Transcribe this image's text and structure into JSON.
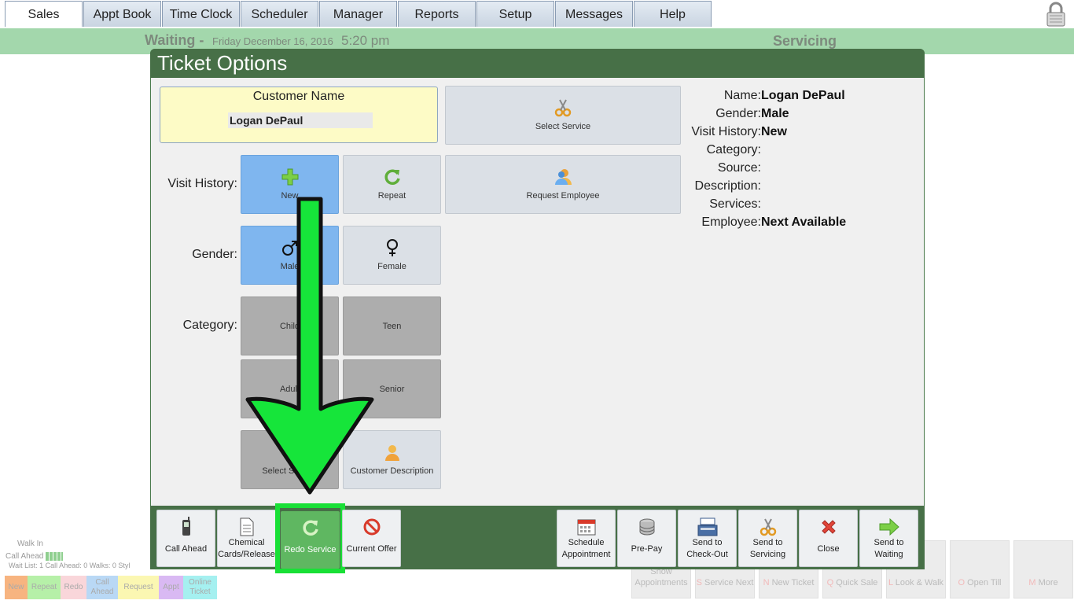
{
  "nav": {
    "tabs": [
      "Sales",
      "Appt Book",
      "Time Clock",
      "Scheduler",
      "Manager",
      "Reports",
      "Setup",
      "Messages",
      "Help"
    ],
    "active_tab": "Sales"
  },
  "status": {
    "waiting_label": "Waiting -",
    "date": "Friday December 16, 2016",
    "time": "5:20 pm",
    "servicing_label": "Servicing"
  },
  "background": {
    "walk_in": "Walk In",
    "call_ahead": "Call Ahead",
    "wait_list": "Wait List: 1   Call Ahead: 0   Walks: 0   Styl",
    "legend": [
      {
        "label": "New",
        "color": "#f7b480"
      },
      {
        "label": "Repeat",
        "color": "#b6f0a8"
      },
      {
        "label": "Redo",
        "color": "#f9d6da"
      },
      {
        "label": "Call Ahead",
        "color": "#b9d8f5"
      },
      {
        "label": "Request",
        "color": "#fbf7b2"
      },
      {
        "label": "Appt",
        "color": "#d9b9f3"
      },
      {
        "label": "Online Ticket",
        "color": "#a5f0f0"
      }
    ],
    "buttons": [
      {
        "key": "",
        "label": "Show Appointments"
      },
      {
        "key": "S",
        "label": "Service Next"
      },
      {
        "key": "N",
        "label": "New Ticket"
      },
      {
        "key": "Q",
        "label": "Quick Sale"
      },
      {
        "key": "L",
        "label": "Look & Walk"
      },
      {
        "key": "O",
        "label": "Open Till"
      },
      {
        "key": "M",
        "label": "More"
      }
    ]
  },
  "modal": {
    "title": "Ticket Options",
    "customer_name_label": "Customer Name",
    "customer_name_value": "Logan DePaul",
    "select_service_top": "Select Service",
    "request_employee": "Request Employee",
    "visit_history_label": "Visit History:",
    "gender_label": "Gender:",
    "category_label": "Category:",
    "visit_options": [
      {
        "label": "New",
        "selected": true,
        "icon": "plus-icon"
      },
      {
        "label": "Repeat",
        "selected": false,
        "icon": "refresh-icon"
      }
    ],
    "gender_options": [
      {
        "label": "Male",
        "selected": true,
        "icon": "male-icon"
      },
      {
        "label": "Female",
        "selected": false,
        "icon": "female-icon"
      }
    ],
    "category_options": [
      "Child",
      "Teen",
      "Adult",
      "Senior"
    ],
    "select_service_bottom": "Select Service",
    "customer_description": "Customer Description",
    "info": {
      "name_k": "Name:",
      "name_v": "Logan DePaul",
      "gender_k": "Gender:",
      "gender_v": "Male",
      "visit_k": "Visit History:",
      "visit_v": "New",
      "category_k": "Category:",
      "category_v": "",
      "source_k": "Source:",
      "source_v": "",
      "description_k": "Description:",
      "description_v": "",
      "services_k": "Services:",
      "services_v": "",
      "employee_k": "Employee:",
      "employee_v": "Next Available"
    },
    "footer_left": [
      {
        "label": "Call Ahead",
        "icon": "phone-icon"
      },
      {
        "label": "Chemical Cards/Release",
        "icon": "document-icon"
      },
      {
        "label": "Redo Service",
        "icon": "redo-icon"
      },
      {
        "label": "Current Offer",
        "icon": "no-icon"
      }
    ],
    "footer_right": [
      {
        "label": "Schedule Appointment",
        "icon": "calendar-icon"
      },
      {
        "label": "Pre-Pay",
        "icon": "coins-icon"
      },
      {
        "label": "Send to Check-Out",
        "icon": "register-icon"
      },
      {
        "label": "Send to Servicing",
        "icon": "scissors-icon"
      },
      {
        "label": "Close",
        "icon": "close-icon"
      },
      {
        "label": "Send to Waiting",
        "icon": "arrow-right-icon"
      }
    ]
  },
  "colors": {
    "header_green": "#477047",
    "status_green": "#a3d7ac",
    "selected_blue": "#7fb6ef",
    "highlight_green": "#19e036"
  }
}
